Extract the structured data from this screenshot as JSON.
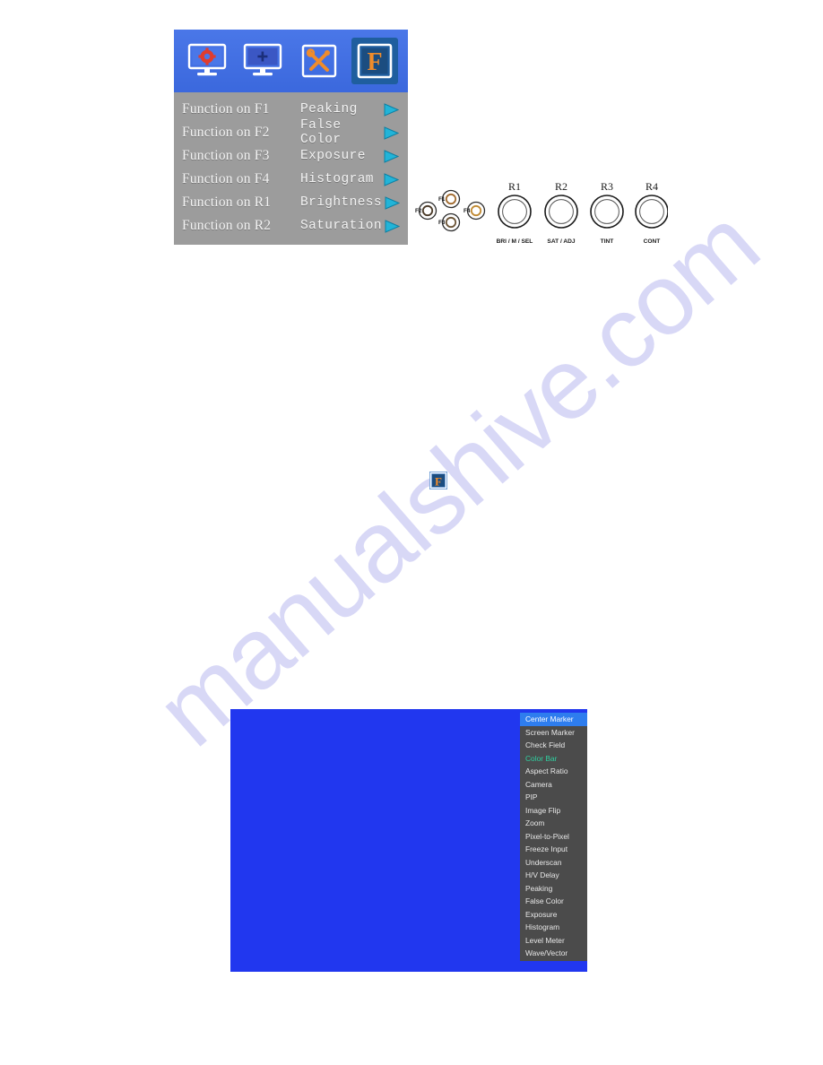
{
  "watermark": {
    "text": "manualshive.com"
  },
  "osd_menu": {
    "tabs": [
      {
        "name": "picture-settings-tab",
        "icon": "monitor-gear-icon",
        "selected": false
      },
      {
        "name": "marker-tab",
        "icon": "monitor-crosshair-icon",
        "selected": false
      },
      {
        "name": "system-tools-tab",
        "icon": "wrench-screwdriver-icon",
        "selected": false
      },
      {
        "name": "function-tab",
        "icon": "letter-f-icon",
        "selected": true
      }
    ],
    "rows": [
      {
        "label": "Function on F1",
        "value": "Peaking",
        "arrow": "right-triangle-icon"
      },
      {
        "label": "Function on F2",
        "value": "False Color",
        "arrow": "right-triangle-icon"
      },
      {
        "label": "Function on F3",
        "value": "Exposure",
        "arrow": "right-triangle-icon"
      },
      {
        "label": "Function on F4",
        "value": "Histogram",
        "arrow": "right-triangle-icon"
      },
      {
        "label": "Function on R1",
        "value": "Brightness",
        "arrow": "right-triangle-icon"
      },
      {
        "label": "Function on R2",
        "value": "Saturation",
        "arrow": "right-triangle-icon"
      }
    ]
  },
  "panel_diagram": {
    "buttons": [
      {
        "id": "F1",
        "label": "F1"
      },
      {
        "id": "F2",
        "label": "F2"
      },
      {
        "id": "F3",
        "label": "F3"
      },
      {
        "id": "F4",
        "label": "F4"
      }
    ],
    "knobs": [
      {
        "id": "R1",
        "top_label": "R1",
        "bottom_label": "BRI / M / SEL"
      },
      {
        "id": "R2",
        "top_label": "R2",
        "bottom_label": "SAT / ADJ"
      },
      {
        "id": "R3",
        "top_label": "R3",
        "bottom_label": "TINT"
      },
      {
        "id": "R4",
        "top_label": "R4",
        "bottom_label": "CONT"
      }
    ]
  },
  "inline_icon": {
    "name": "letter-f-icon",
    "letter": "F"
  },
  "screen": {
    "background_color": "#2137ef",
    "menu": {
      "items": [
        {
          "label": "Center Marker",
          "state": "selected"
        },
        {
          "label": "Screen Marker",
          "state": "normal"
        },
        {
          "label": "Check Field",
          "state": "normal"
        },
        {
          "label": "Color Bar",
          "state": "highlight"
        },
        {
          "label": "Aspect Ratio",
          "state": "normal"
        },
        {
          "label": "Camera",
          "state": "normal"
        },
        {
          "label": "PIP",
          "state": "normal"
        },
        {
          "label": "Image Flip",
          "state": "normal"
        },
        {
          "label": "Zoom",
          "state": "normal"
        },
        {
          "label": "Pixel-to-Pixel",
          "state": "normal"
        },
        {
          "label": "Freeze Input",
          "state": "normal"
        },
        {
          "label": "Underscan",
          "state": "normal"
        },
        {
          "label": "H/V Delay",
          "state": "normal"
        },
        {
          "label": "Peaking",
          "state": "normal"
        },
        {
          "label": "False Color",
          "state": "normal"
        },
        {
          "label": "Exposure",
          "state": "normal"
        },
        {
          "label": "Histogram",
          "state": "normal"
        },
        {
          "label": "Level Meter",
          "state": "normal"
        },
        {
          "label": "Wave/Vector",
          "state": "normal"
        }
      ]
    }
  },
  "colors": {
    "osd_tabbar_blue": "#3f6de0",
    "osd_tab_selected": "#1f5e9e",
    "osd_panel_gray": "#9c9c9c",
    "osd_arrow_cyan": "#22b4d8",
    "screen_blue": "#2137ef",
    "screen_menu_gray": "#4b4b4b",
    "screen_item_selected": "#2e7dee",
    "screen_item_highlight": "#2fd0a0",
    "watermark": "#d8d8f6"
  }
}
